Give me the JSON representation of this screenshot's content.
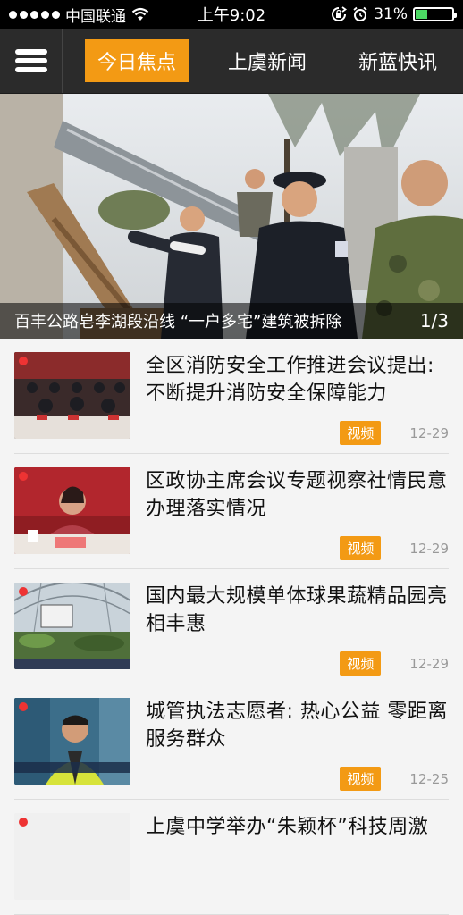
{
  "status_bar": {
    "carrier": "中国联通",
    "time": "上午9:02",
    "battery_percent": "31%",
    "battery_level": 0.31,
    "icons": [
      "signal-dots-icon",
      "wifi-icon",
      "rotation-lock-icon",
      "alarm-icon",
      "battery-icon"
    ]
  },
  "nav": {
    "menu_icon": "hamburger-menu-icon",
    "tabs": [
      {
        "label": "今日焦点",
        "active": true
      },
      {
        "label": "上虞新闻",
        "active": false
      },
      {
        "label": "新蓝快讯",
        "active": false
      }
    ],
    "accent_color": "#f39a14"
  },
  "hero": {
    "caption": "百丰公路皂李湖段沿线 “一户多宅”建筑被拆除",
    "pager": "1/3"
  },
  "news": [
    {
      "title": "全区消防安全工作推进会议提出: 不断提升消防安全保障能力",
      "badge": "视频",
      "date": "12-29"
    },
    {
      "title": "区政协主席会议专题视察社情民意办理落实情况",
      "badge": "视频",
      "date": "12-29"
    },
    {
      "title": "国内最大规模单体球果蔬精品园亮相丰惠",
      "badge": "视频",
      "date": "12-29"
    },
    {
      "title": "城管执法志愿者: 热心公益 零距离服务群众",
      "badge": "视频",
      "date": "12-25"
    },
    {
      "title": "上虞中学举办“朱颖杯”科技周激",
      "badge": "",
      "date": ""
    }
  ]
}
